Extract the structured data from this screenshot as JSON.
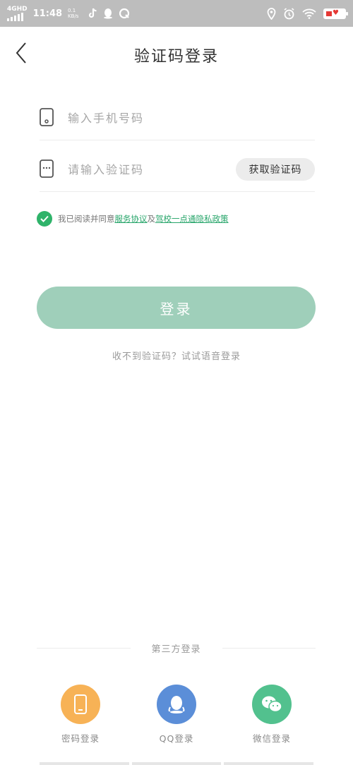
{
  "status_bar": {
    "network": "4GHD",
    "time": "11:48",
    "speed_value": "0.1",
    "speed_unit": "KB/s"
  },
  "header": {
    "title": "验证码登录"
  },
  "phone_field": {
    "placeholder": "输入手机号码"
  },
  "code_field": {
    "placeholder": "请输入验证码",
    "get_code_label": "获取验证码"
  },
  "agreement": {
    "prefix": "我已阅读并同意",
    "link1": "服务协议",
    "middle": "及",
    "link2": "驾校一点通隐私政策"
  },
  "login_label": "登录",
  "voice_login": "收不到验证码？试试语音登录",
  "third_party": {
    "title": "第三方登录",
    "options": [
      {
        "label": "密码登录",
        "color": "#f7b256",
        "icon": "phone-icon"
      },
      {
        "label": "QQ登录",
        "color": "#5b8ed8",
        "icon": "qq-icon"
      },
      {
        "label": "微信登录",
        "color": "#52c18e",
        "icon": "wechat-icon"
      }
    ]
  },
  "colors": {
    "accent": "#2fb36a",
    "login_button": "#9fcfba",
    "link": "#27a56a"
  }
}
